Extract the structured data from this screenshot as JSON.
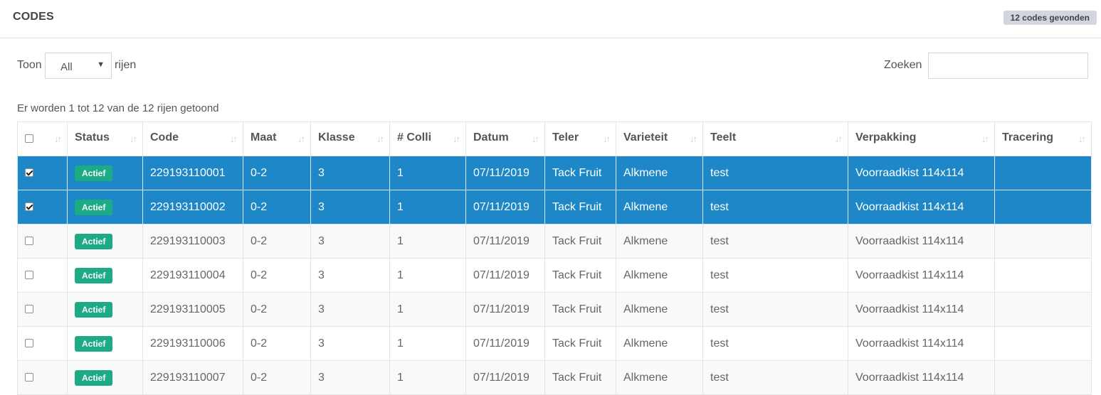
{
  "header": {
    "title": "CODES",
    "badge": "12 codes gevonden"
  },
  "controls": {
    "length_prefix": "Toon",
    "length_value": "All",
    "length_suffix": "rijen",
    "search_label": "Zoeken",
    "search_value": ""
  },
  "info": "Er worden 1 tot 12 van de 12 rijen getoond",
  "table": {
    "columns": [
      "",
      "Status",
      "Code",
      "Maat",
      "Klasse",
      "# Colli",
      "Datum",
      "Teler",
      "Varieteit",
      "Teelt",
      "Verpakking",
      "Tracering"
    ],
    "rows": [
      {
        "selected": true,
        "status": "Actief",
        "code": "229193110001",
        "maat": "0-2",
        "klasse": "3",
        "colli": "1",
        "datum": "07/11/2019",
        "teler": "Tack Fruit",
        "varieteit": "Alkmene",
        "teelt": "test",
        "verpakking": "Voorraadkist 114x114",
        "tracering": ""
      },
      {
        "selected": true,
        "status": "Actief",
        "code": "229193110002",
        "maat": "0-2",
        "klasse": "3",
        "colli": "1",
        "datum": "07/11/2019",
        "teler": "Tack Fruit",
        "varieteit": "Alkmene",
        "teelt": "test",
        "verpakking": "Voorraadkist 114x114",
        "tracering": ""
      },
      {
        "selected": false,
        "status": "Actief",
        "code": "229193110003",
        "maat": "0-2",
        "klasse": "3",
        "colli": "1",
        "datum": "07/11/2019",
        "teler": "Tack Fruit",
        "varieteit": "Alkmene",
        "teelt": "test",
        "verpakking": "Voorraadkist 114x114",
        "tracering": ""
      },
      {
        "selected": false,
        "status": "Actief",
        "code": "229193110004",
        "maat": "0-2",
        "klasse": "3",
        "colli": "1",
        "datum": "07/11/2019",
        "teler": "Tack Fruit",
        "varieteit": "Alkmene",
        "teelt": "test",
        "verpakking": "Voorraadkist 114x114",
        "tracering": ""
      },
      {
        "selected": false,
        "status": "Actief",
        "code": "229193110005",
        "maat": "0-2",
        "klasse": "3",
        "colli": "1",
        "datum": "07/11/2019",
        "teler": "Tack Fruit",
        "varieteit": "Alkmene",
        "teelt": "test",
        "verpakking": "Voorraadkist 114x114",
        "tracering": ""
      },
      {
        "selected": false,
        "status": "Actief",
        "code": "229193110006",
        "maat": "0-2",
        "klasse": "3",
        "colli": "1",
        "datum": "07/11/2019",
        "teler": "Tack Fruit",
        "varieteit": "Alkmene",
        "teelt": "test",
        "verpakking": "Voorraadkist 114x114",
        "tracering": ""
      },
      {
        "selected": false,
        "status": "Actief",
        "code": "229193110007",
        "maat": "0-2",
        "klasse": "3",
        "colli": "1",
        "datum": "07/11/2019",
        "teler": "Tack Fruit",
        "varieteit": "Alkmene",
        "teelt": "test",
        "verpakking": "Voorraadkist 114x114",
        "tracering": ""
      }
    ]
  },
  "icons": {
    "sort": "sort-both-icon",
    "select": "chevron-down-icon",
    "checkbox": "checkbox-icon"
  },
  "colors": {
    "selected_row": "#1e87c8",
    "status_badge": "#1cab84",
    "header_badge": "#d2d6de"
  }
}
